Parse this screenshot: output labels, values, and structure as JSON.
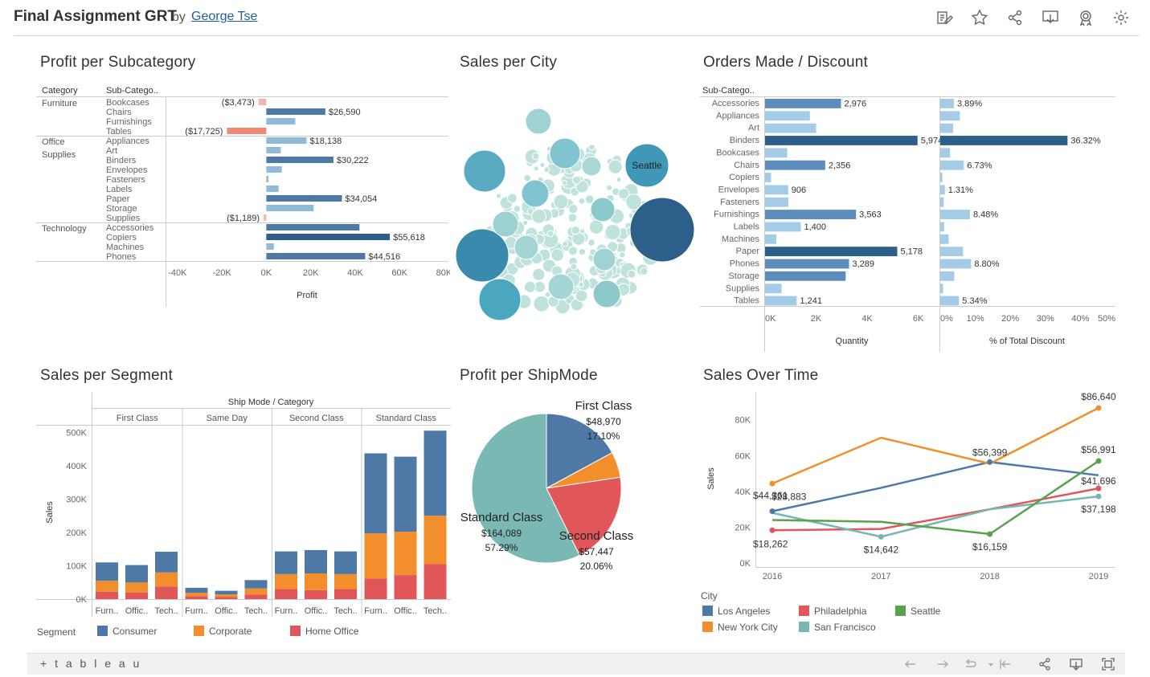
{
  "header": {
    "title": "Final Assignment GRT",
    "by": "by",
    "author": "George Tse",
    "icons": [
      "edit-icon",
      "star-icon",
      "share-icon",
      "download-icon",
      "badge-icon",
      "gear-icon"
    ]
  },
  "sheets": {
    "profit_subcat": "Profit per Subcategory",
    "sales_city": "Sales per City",
    "orders_discount": "Orders Made / Discount",
    "sales_segment": "Sales per Segment",
    "profit_shipmode": "Profit per ShipMode",
    "sales_time": "Sales Over Time"
  },
  "colors": {
    "bar_blue": "#4e79a7",
    "light_blue": "#8fbbd9",
    "dark_blue": "#2c5f8a",
    "negative": "#f08873",
    "orange": "#f28e2b",
    "red": "#e15759",
    "green": "#59a14f",
    "teal": "#76b7b2"
  },
  "chart_data": [
    {
      "id": "profit_per_subcategory",
      "type": "bar",
      "title": "Profit per Subcategory",
      "xlabel": "Profit",
      "col_headers": [
        "Category",
        "Sub-Catego.."
      ],
      "xlim": [
        -45000,
        82000
      ],
      "ticks": [
        "-40K",
        "-20K",
        "0K",
        "20K",
        "40K",
        "60K",
        "80K"
      ],
      "tick_values": [
        -40000,
        -20000,
        0,
        20000,
        40000,
        60000,
        80000
      ],
      "groups": [
        {
          "category": "Furniture",
          "items": [
            {
              "name": "Bookcases",
              "value": -3473,
              "label": "($3,473)"
            },
            {
              "name": "Chairs",
              "value": 26590,
              "label": "$26,590"
            },
            {
              "name": "Furnishings",
              "value": 13059,
              "label": ""
            },
            {
              "name": "Tables",
              "value": -17725,
              "label": "($17,725)"
            }
          ]
        },
        {
          "category": "Office Supplies",
          "items": [
            {
              "name": "Appliances",
              "value": 18138,
              "label": "$18,138"
            },
            {
              "name": "Art",
              "value": 6528,
              "label": ""
            },
            {
              "name": "Binders",
              "value": 30222,
              "label": "$30,222"
            },
            {
              "name": "Envelopes",
              "value": 6964,
              "label": ""
            },
            {
              "name": "Fasteners",
              "value": 950,
              "label": ""
            },
            {
              "name": "Labels",
              "value": 5546,
              "label": ""
            },
            {
              "name": "Paper",
              "value": 34054,
              "label": "$34,054"
            },
            {
              "name": "Storage",
              "value": 21279,
              "label": ""
            },
            {
              "name": "Supplies",
              "value": -1189,
              "label": "($1,189)"
            }
          ]
        },
        {
          "category": "Technology",
          "items": [
            {
              "name": "Accessories",
              "value": 41937,
              "label": ""
            },
            {
              "name": "Copiers",
              "value": 55618,
              "label": "$55,618"
            },
            {
              "name": "Machines",
              "value": 3385,
              "label": ""
            },
            {
              "name": "Phones",
              "value": 44516,
              "label": "$44,516"
            }
          ]
        }
      ]
    },
    {
      "id": "sales_per_city",
      "type": "bubble",
      "title": "Sales per City",
      "labels": [
        "Seattle"
      ]
    },
    {
      "id": "orders_discount",
      "type": "bar",
      "title": "Orders Made / Discount",
      "col_header": "Sub-Catego..",
      "categories": [
        "Accessories",
        "Appliances",
        "Art",
        "Binders",
        "Bookcases",
        "Chairs",
        "Copiers",
        "Envelopes",
        "Fasteners",
        "Furnishings",
        "Labels",
        "Machines",
        "Paper",
        "Phones",
        "Storage",
        "Supplies",
        "Tables"
      ],
      "quantity": {
        "xlabel": "Quantity",
        "ticks": [
          "0K",
          "2K",
          "4K",
          "6K"
        ],
        "tick_values": [
          0,
          2000,
          4000,
          6000
        ],
        "xlim": [
          0,
          6800
        ],
        "values": [
          2976,
          1755,
          2000,
          5974,
          868,
          2356,
          234,
          906,
          914,
          3563,
          1400,
          440,
          5178,
          3289,
          3158,
          647,
          1241
        ],
        "labels": [
          "2,976",
          "",
          "",
          "5,974",
          "",
          "2,356",
          "",
          "906",
          "",
          "3,563",
          "1,400",
          "",
          "5,178",
          "3,289",
          "",
          "",
          "1,241"
        ]
      },
      "discount": {
        "xlabel": "% of Total Discount",
        "ticks": [
          "0%",
          "10%",
          "20%",
          "30%",
          "40%",
          "50%"
        ],
        "tick_values": [
          0,
          10,
          20,
          30,
          40,
          50
        ],
        "xlim": [
          0,
          50
        ],
        "values": [
          3.89,
          5.6,
          3.7,
          36.32,
          2.8,
          6.73,
          0.6,
          1.31,
          1.0,
          8.48,
          1.1,
          2.4,
          6.5,
          8.8,
          4.0,
          0.8,
          5.34
        ],
        "labels": [
          "3.89%",
          "",
          "",
          "36.32%",
          "",
          "6.73%",
          "",
          "1.31%",
          "",
          "8.48%",
          "",
          "",
          "",
          "8.80%",
          "",
          "",
          "5.34%"
        ]
      }
    },
    {
      "id": "sales_per_segment",
      "type": "bar",
      "title": "Sales per Segment",
      "header": "Ship Mode / Category",
      "ylabel": "Sales",
      "ylim": [
        0,
        520000
      ],
      "ticks": [
        "0K",
        "100K",
        "200K",
        "300K",
        "400K",
        "500K"
      ],
      "tick_values": [
        0,
        100000,
        200000,
        300000,
        400000,
        500000
      ],
      "ship_modes": [
        "First Class",
        "Same Day",
        "Second Class",
        "Standard Class"
      ],
      "category_labels": [
        "Furn..",
        "Offic..",
        "Tech.."
      ],
      "series": [
        {
          "name": "Consumer",
          "values": [
            [
              55000,
              52000,
              62000
            ],
            [
              15000,
              11000,
              25000
            ],
            [
              68000,
              70000,
              68000
            ],
            [
              240000,
              225000,
              255000
            ]
          ]
        },
        {
          "name": "Corporate",
          "values": [
            [
              33000,
              30000,
              42000
            ],
            [
              10000,
              8000,
              18000
            ],
            [
              45000,
              50000,
              45000
            ],
            [
              135000,
              130000,
              145000
            ]
          ]
        },
        {
          "name": "Home Office",
          "values": [
            [
              22000,
              20000,
              38000
            ],
            [
              9000,
              6000,
              14000
            ],
            [
              30000,
              27000,
              30000
            ],
            [
              62000,
              72000,
              105000
            ]
          ]
        }
      ]
    },
    {
      "id": "profit_per_shipmode",
      "type": "pie",
      "title": "Profit per ShipMode",
      "slices": [
        {
          "name": "First Class",
          "value": 48970,
          "label": "$48,970",
          "pct": "17.10%"
        },
        {
          "name": "Same Day",
          "value": 15892,
          "label": "",
          "pct": ""
        },
        {
          "name": "Second Class",
          "value": 57447,
          "label": "$57,447",
          "pct": "20.06%"
        },
        {
          "name": "Standard Class",
          "value": 164089,
          "label": "$164,089",
          "pct": "57.29%"
        }
      ]
    },
    {
      "id": "sales_over_time",
      "type": "line",
      "title": "Sales Over Time",
      "ylabel": "Sales",
      "x": [
        "2016",
        "2017",
        "2018",
        "2019"
      ],
      "ylim": [
        0,
        92000
      ],
      "ticks": [
        "0K",
        "20K",
        "40K",
        "60K",
        "80K"
      ],
      "tick_values": [
        0,
        20000,
        40000,
        60000,
        80000
      ],
      "legend_title": "City",
      "series": [
        {
          "name": "Los Angeles",
          "values": [
            28883,
            42000,
            56399,
            49000
          ]
        },
        {
          "name": "New York City",
          "values": [
            44361,
            70000,
            55500,
            86640
          ]
        },
        {
          "name": "Philadelphia",
          "values": [
            18262,
            19000,
            30000,
            41696
          ]
        },
        {
          "name": "San Francisco",
          "values": [
            28000,
            14642,
            30000,
            37198
          ]
        },
        {
          "name": "Seattle",
          "values": [
            24000,
            23000,
            16159,
            56991
          ]
        }
      ],
      "point_labels": [
        {
          "text": "$28,883",
          "series": 0,
          "i": 0
        },
        {
          "text": "$44,361",
          "series": 1,
          "i": 0
        },
        {
          "text": "$18,262",
          "series": 2,
          "i": 0
        },
        {
          "text": "$14,642",
          "series": 3,
          "i": 1
        },
        {
          "text": "$56,399",
          "series": 0,
          "i": 2
        },
        {
          "text": "$16,159",
          "series": 4,
          "i": 2
        },
        {
          "text": "$86,640",
          "series": 1,
          "i": 3
        },
        {
          "text": "$56,991",
          "series": 4,
          "i": 3
        },
        {
          "text": "$41,696",
          "series": 2,
          "i": 3
        },
        {
          "text": "$37,198",
          "series": 3,
          "i": 3
        }
      ]
    }
  ],
  "segment_legend": {
    "title": "Segment",
    "items": [
      "Consumer",
      "Corporate",
      "Home Office"
    ]
  },
  "footer": {
    "logo": "+ t a b l e a u"
  }
}
